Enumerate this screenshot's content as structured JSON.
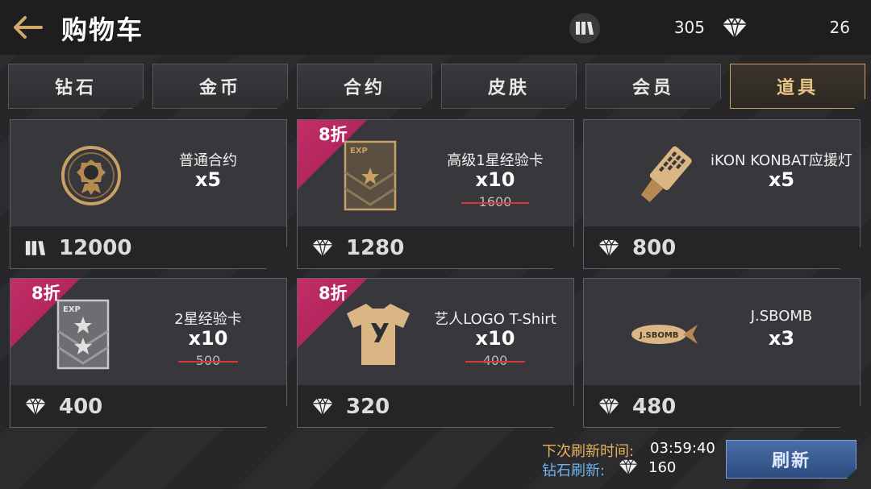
{
  "header": {
    "title": "购物车",
    "ticket_count": "305",
    "diamond_count": "26"
  },
  "tabs": [
    {
      "label": "钻石",
      "active": false
    },
    {
      "label": "金币",
      "active": false
    },
    {
      "label": "合约",
      "active": false
    },
    {
      "label": "皮肤",
      "active": false
    },
    {
      "label": "会员",
      "active": false
    },
    {
      "label": "道具",
      "active": true
    }
  ],
  "items": [
    {
      "name": "普通合约",
      "qty": "x5",
      "price": "12000",
      "currency": "ticket-icon",
      "discount": "",
      "original_price": ""
    },
    {
      "name": "高级1星经验卡",
      "qty": "x10",
      "price": "1280",
      "currency": "diamond-icon",
      "discount": "8折",
      "original_price": "1600"
    },
    {
      "name": "iKON KONBAT应援灯",
      "qty": "x5",
      "price": "800",
      "currency": "diamond-icon",
      "discount": "",
      "original_price": ""
    },
    {
      "name": "2星经验卡",
      "qty": "x10",
      "price": "400",
      "currency": "diamond-icon",
      "discount": "8折",
      "original_price": "500"
    },
    {
      "name": "艺人LOGO T-Shirt",
      "qty": "x10",
      "price": "320",
      "currency": "diamond-icon",
      "discount": "8折",
      "original_price": "400"
    },
    {
      "name": "J.SBOMB",
      "qty": "x3",
      "price": "480",
      "currency": "diamond-icon",
      "discount": "",
      "original_price": ""
    }
  ],
  "footer": {
    "refresh_time_label": "下次刷新时间:",
    "refresh_time": "03:59:40",
    "refresh_cost_label": "钻石刷新:",
    "refresh_cost": "160",
    "refresh_button": "刷新"
  },
  "art_labels": {
    "exp_card": "EXP",
    "bomb_text": "J.SBOMB"
  },
  "colors": {
    "accent_gold": "#c9a166",
    "discount_pink": "#c42e68",
    "refresh_blue": "#2c4c7f",
    "label_orange": "#e7b35a",
    "label_blue": "#6fb4f0"
  }
}
